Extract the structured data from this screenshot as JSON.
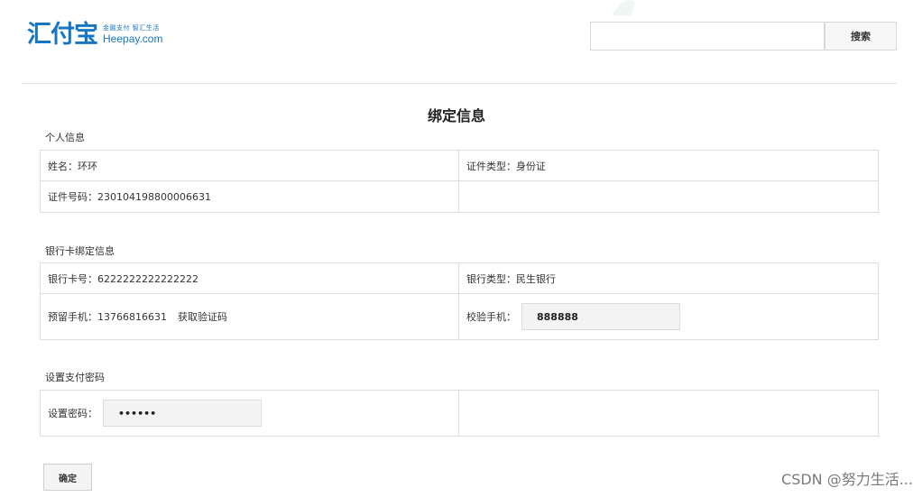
{
  "header": {
    "logo_text": "汇付宝",
    "logo_slogan": "金融支付 智汇生活",
    "logo_domain": "Heepay.com",
    "search_value": "",
    "search_button": "搜索"
  },
  "page_title": "绑定信息",
  "personal": {
    "section_label": "个人信息",
    "name": "姓名：环环",
    "id_type": "证件类型：身份证",
    "id_number": "证件号码：230104198800006631"
  },
  "bank": {
    "section_label": "银行卡绑定信息",
    "card_number": "银行卡号：6222222222222222",
    "bank_type": "银行类型：民生银行",
    "phone": "预留手机：13766816631",
    "get_code_link": "获取验证码",
    "verify_label": "校验手机：",
    "verify_value": "888888"
  },
  "password": {
    "section_label": "设置支付密码",
    "label": "设置密码：",
    "value": "••••••"
  },
  "confirm_button": "确定",
  "watermark": "CSDN @努力生活..."
}
